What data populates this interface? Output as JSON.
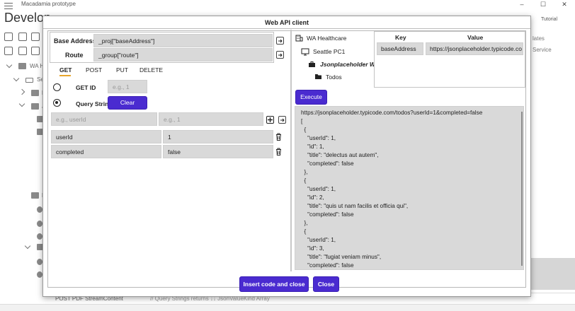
{
  "app": {
    "window_title": "Macadamia prototype",
    "heading": "Develop",
    "tutorial_label": "Tutorial",
    "window_controls": [
      "–",
      "☐",
      "✕"
    ],
    "tree_fragments": [
      "WA H",
      "Sea",
      "H",
      "Js",
      "M"
    ],
    "right_panel": {
      "templates": "lates",
      "service": "Service"
    },
    "bottom_row": {
      "left": "POST PDF StreamContent",
      "middle": "// Query Strings returns ↓↓ JsonValueKind Array"
    }
  },
  "dialog": {
    "title": "Web API client",
    "base_address": {
      "label": "Base Address",
      "value": "_proj[\"baseAddress\"]"
    },
    "route": {
      "label": "Route",
      "value": "_group[\"route\"]"
    },
    "tabs": [
      {
        "label": "GET",
        "active": true
      },
      {
        "label": "POST",
        "active": false
      },
      {
        "label": "PUT",
        "active": false
      },
      {
        "label": "DELETE",
        "active": false
      }
    ],
    "get_id": {
      "label": "GET ID",
      "placeholder": "e.g., 1",
      "selected": false
    },
    "query_strings": {
      "label": "Query Strings",
      "selected": true,
      "clear_label": "Clear"
    },
    "new_param": {
      "key_placeholder": "e.g., userId",
      "value_placeholder": "e.g., 1"
    },
    "params": [
      {
        "key": "userId",
        "value": "1"
      },
      {
        "key": "completed",
        "value": "false"
      }
    ],
    "tree": [
      {
        "label": "WA Healthcare",
        "icon": "building-icon"
      },
      {
        "label": "Seattle PC1",
        "icon": "monitor-icon"
      },
      {
        "label": "Jsonplaceholder Web",
        "icon": "briefcase-icon"
      },
      {
        "label": "Todos",
        "icon": "folder-icon"
      }
    ],
    "kv": {
      "headers": [
        "Key",
        "Value"
      ],
      "rows": [
        {
          "key": "baseAddress",
          "value": "https://jsonplaceholder.typicode.co"
        }
      ]
    },
    "execute_label": "Execute",
    "result_text": "https://jsonplaceholder.typicode.com/todos?userId=1&completed=false\n[\n  {\n    \"userId\": 1,\n    \"id\": 1,\n    \"title\": \"delectus aut autem\",\n    \"completed\": false\n  },\n  {\n    \"userId\": 1,\n    \"id\": 2,\n    \"title\": \"quis ut nam facilis et officia qui\",\n    \"completed\": false\n  },\n  {\n    \"userId\": 1,\n    \"id\": 3,\n    \"title\": \"fugiat veniam minus\",\n    \"completed\": false\n  },\n  {",
    "insert_label": "Insert code and close",
    "close_label": "Close"
  },
  "colors": {
    "accent": "#4a2bd0",
    "tab_underline": "#e8a52b",
    "field_bg": "#d9d9d9"
  }
}
